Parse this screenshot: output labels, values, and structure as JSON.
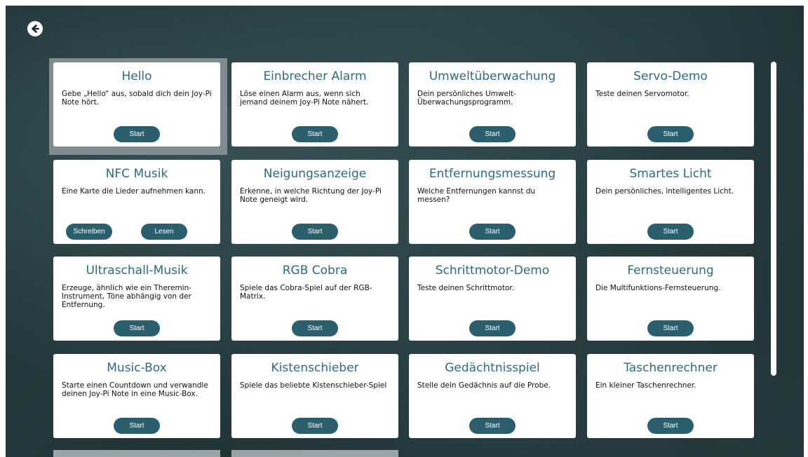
{
  "navigation": {
    "back_icon": "arrow-left-circle-icon"
  },
  "colors": {
    "title_text": "#2d6b7e",
    "button_bg": "#2c5f6d",
    "selection_frame": "#7f8c90"
  },
  "cards": [
    {
      "title": "Hello",
      "description": "Gebe „Hello“ aus, sobald dich dein Joy-Pi Note hört.",
      "buttons": [
        "Start"
      ],
      "selected": true
    },
    {
      "title": "Einbrecher Alarm",
      "description": "Löse einen Alarm aus, wenn sich jemand deinem Joy-Pi Note nähert.",
      "buttons": [
        "Start"
      ]
    },
    {
      "title": "Umweltüberwachung",
      "description": "Dein persönliches Umwelt-Überwachungsprogramm.",
      "buttons": [
        "Start"
      ]
    },
    {
      "title": "Servo-Demo",
      "description": "Teste deinen Servomotor.",
      "buttons": [
        "Start"
      ]
    },
    {
      "title": "NFC Musik",
      "description": "Eine Karte die Lieder aufnehmen kann.",
      "buttons": [
        "Schreiben",
        "Lesen"
      ]
    },
    {
      "title": "Neigungsanzeige",
      "description": "Erkenne, in welche Richtung der Joy-Pi Note geneigt wird.",
      "buttons": [
        "Start"
      ]
    },
    {
      "title": "Entfernungsmessung",
      "description": "Welche Entfernungen kannst du messen?",
      "buttons": [
        "Start"
      ]
    },
    {
      "title": "Smartes Licht",
      "description": "Dein persönliches, intelligentes Licht.",
      "buttons": [
        "Start"
      ]
    },
    {
      "title": "Ultraschall-Musik",
      "description": "Erzeuge, ähnlich wie ein Theremin-Instrument, Töne abhängig von der Entfernung.",
      "buttons": [
        "Start"
      ]
    },
    {
      "title": "RGB Cobra",
      "description": "Spiele das Cobra-Spiel auf der RGB-Matrix.",
      "buttons": [
        "Start"
      ]
    },
    {
      "title": "Schrittmotor-Demo",
      "description": "Teste deinen Schrittmotor.",
      "buttons": [
        "Start"
      ]
    },
    {
      "title": "Fernsteuerung",
      "description": "Die Multifunktions-Fernsteuerung.",
      "buttons": [
        "Start"
      ]
    },
    {
      "title": "Music-Box",
      "description": "Starte einen Countdown und verwandle deinen Joy-Pi Note in eine Music-Box.",
      "buttons": [
        "Start"
      ]
    },
    {
      "title": "Kistenschieber",
      "description": "Spiele das beliebte Kistenschieber-Spiel",
      "buttons": [
        "Start"
      ]
    },
    {
      "title": "Gedächtnisspiel",
      "description": "Stelle dein Gedächnis auf die Probe.",
      "buttons": [
        "Start"
      ]
    },
    {
      "title": "Taschenrechner",
      "description": "Ein kleiner Taschenrechner.",
      "buttons": [
        "Start"
      ]
    }
  ]
}
